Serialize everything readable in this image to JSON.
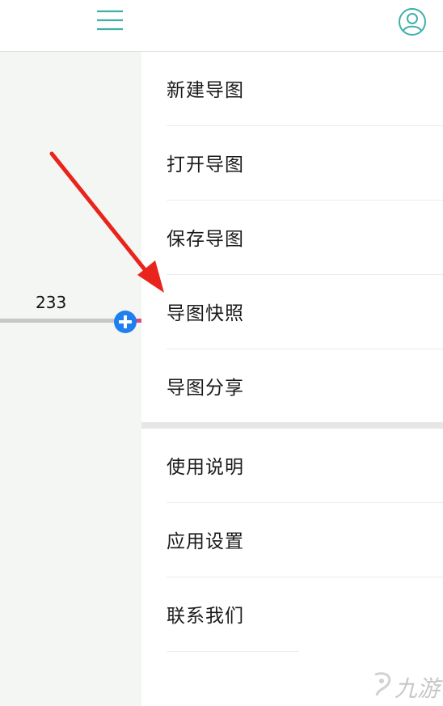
{
  "header": {
    "menu_icon": "hamburger-menu-icon",
    "user_icon": "user-account-icon",
    "accent_color": "#3fb0a8"
  },
  "canvas": {
    "node_text": "233",
    "add_icon": "plus-circle-icon",
    "add_color": "#1f7ff0"
  },
  "menu": {
    "group1": [
      {
        "label": "新建导图"
      },
      {
        "label": "打开导图"
      },
      {
        "label": "保存导图"
      },
      {
        "label": "导图快照"
      },
      {
        "label": "导图分享"
      }
    ],
    "group2": [
      {
        "label": "使用说明"
      },
      {
        "label": "应用设置"
      },
      {
        "label": "联系我们"
      }
    ]
  },
  "annotation": {
    "arrow_color": "#e8241c"
  },
  "watermark": {
    "text": "九游"
  }
}
